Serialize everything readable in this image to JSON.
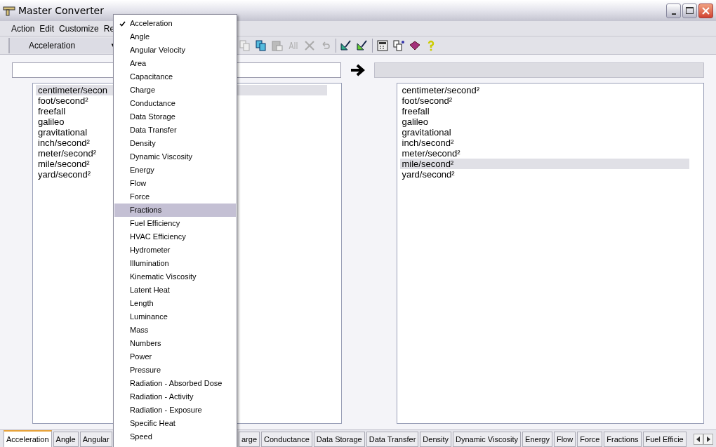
{
  "window": {
    "title": "Master Converter"
  },
  "menu_bar": [
    "Action",
    "Edit",
    "Customize",
    "Re"
  ],
  "toolbar": {
    "category": "Acceleration"
  },
  "toolbar_caret": "▼",
  "from_list": [
    {
      "label": "centimeter/secon",
      "selected": true
    },
    {
      "label": "foot/second²",
      "selected": false
    },
    {
      "label": "freefall",
      "selected": false
    },
    {
      "label": "galileo",
      "selected": false
    },
    {
      "label": "gravitational",
      "selected": false
    },
    {
      "label": "inch/second²",
      "selected": false
    },
    {
      "label": "meter/second²",
      "selected": false
    },
    {
      "label": "mile/second²",
      "selected": false
    },
    {
      "label": "yard/second²",
      "selected": false
    }
  ],
  "to_list": [
    {
      "label": "centimeter/second²",
      "selected": false
    },
    {
      "label": "foot/second²",
      "selected": false
    },
    {
      "label": "freefall",
      "selected": false
    },
    {
      "label": "galileo",
      "selected": false
    },
    {
      "label": "gravitational",
      "selected": false
    },
    {
      "label": "inch/second²",
      "selected": false
    },
    {
      "label": "meter/second²",
      "selected": false
    },
    {
      "label": "mile/second²",
      "selected": true
    },
    {
      "label": "yard/second²",
      "selected": false
    }
  ],
  "category_menu": [
    {
      "label": "Acceleration",
      "checked": true,
      "hovered": false
    },
    {
      "label": "Angle",
      "checked": false,
      "hovered": false
    },
    {
      "label": "Angular Velocity",
      "checked": false,
      "hovered": false
    },
    {
      "label": "Area",
      "checked": false,
      "hovered": false
    },
    {
      "label": "Capacitance",
      "checked": false,
      "hovered": false
    },
    {
      "label": "Charge",
      "checked": false,
      "hovered": false
    },
    {
      "label": "Conductance",
      "checked": false,
      "hovered": false
    },
    {
      "label": "Data Storage",
      "checked": false,
      "hovered": false
    },
    {
      "label": "Data Transfer",
      "checked": false,
      "hovered": false
    },
    {
      "label": "Density",
      "checked": false,
      "hovered": false
    },
    {
      "label": "Dynamic Viscosity",
      "checked": false,
      "hovered": false
    },
    {
      "label": "Energy",
      "checked": false,
      "hovered": false
    },
    {
      "label": "Flow",
      "checked": false,
      "hovered": false
    },
    {
      "label": "Force",
      "checked": false,
      "hovered": false
    },
    {
      "label": "Fractions",
      "checked": false,
      "hovered": true
    },
    {
      "label": "Fuel Efficiency",
      "checked": false,
      "hovered": false
    },
    {
      "label": "HVAC Efficiency",
      "checked": false,
      "hovered": false
    },
    {
      "label": "Hydrometer",
      "checked": false,
      "hovered": false
    },
    {
      "label": "Illumination",
      "checked": false,
      "hovered": false
    },
    {
      "label": "Kinematic Viscosity",
      "checked": false,
      "hovered": false
    },
    {
      "label": "Latent Heat",
      "checked": false,
      "hovered": false
    },
    {
      "label": "Length",
      "checked": false,
      "hovered": false
    },
    {
      "label": "Luminance",
      "checked": false,
      "hovered": false
    },
    {
      "label": "Mass",
      "checked": false,
      "hovered": false
    },
    {
      "label": "Numbers",
      "checked": false,
      "hovered": false
    },
    {
      "label": "Power",
      "checked": false,
      "hovered": false
    },
    {
      "label": "Pressure",
      "checked": false,
      "hovered": false
    },
    {
      "label": "Radiation - Absorbed Dose",
      "checked": false,
      "hovered": false
    },
    {
      "label": "Radiation - Activity",
      "checked": false,
      "hovered": false
    },
    {
      "label": "Radiation - Exposure",
      "checked": false,
      "hovered": false
    },
    {
      "label": "Specific Heat",
      "checked": false,
      "hovered": false
    },
    {
      "label": "Speed",
      "checked": false,
      "hovered": false
    }
  ],
  "tabs_left": [
    {
      "label": "Acceleration",
      "selected": true
    },
    {
      "label": "Angle",
      "selected": false
    },
    {
      "label": "Angular",
      "selected": false
    }
  ],
  "tabs_right": [
    {
      "label": "arge",
      "selected": false
    },
    {
      "label": "Conductance",
      "selected": false
    },
    {
      "label": "Data Storage",
      "selected": false
    },
    {
      "label": "Data Transfer",
      "selected": false
    },
    {
      "label": "Density",
      "selected": false
    },
    {
      "label": "Dynamic Viscosity",
      "selected": false
    },
    {
      "label": "Energy",
      "selected": false
    },
    {
      "label": "Flow",
      "selected": false
    },
    {
      "label": "Force",
      "selected": false
    },
    {
      "label": "Fractions",
      "selected": false
    },
    {
      "label": "Fuel Efficie",
      "selected": false
    }
  ]
}
